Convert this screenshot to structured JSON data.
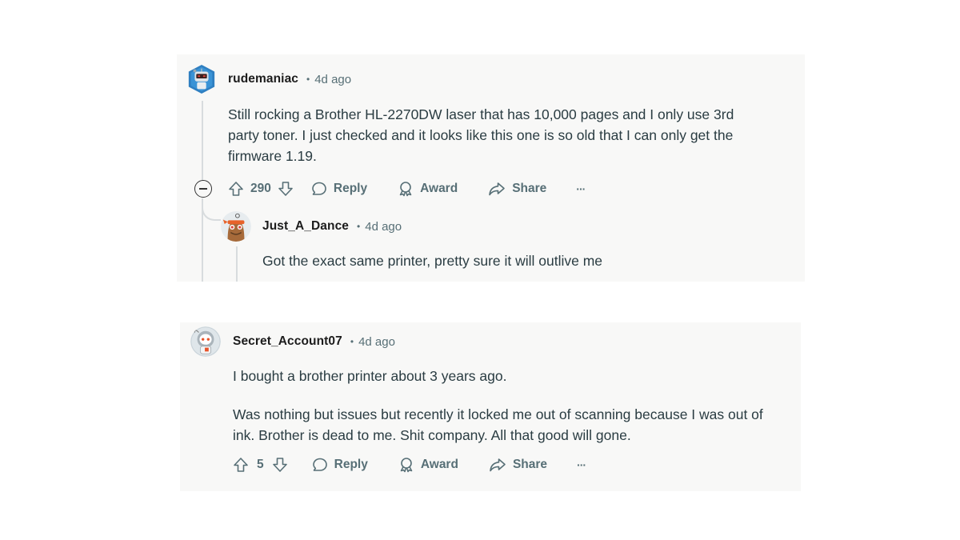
{
  "comments": [
    {
      "username": "rudemaniac",
      "separator": "•",
      "time": "4d ago",
      "avatar": "robot-snoo-avatar",
      "body": [
        "Still rocking a Brother HL-2270DW laser that has 10,000 pages and I only use 3rd",
        "party toner. I just checked and it looks like this one is so old that I can only get the",
        "firmware 1.19."
      ],
      "votes": "290",
      "actions": {
        "reply": "Reply",
        "award": "Award",
        "share": "Share",
        "more": "···"
      },
      "collapse": "collapse-thread",
      "replies": [
        {
          "username": "Just_A_Dance",
          "separator": "•",
          "time": "4d ago",
          "avatar": "pirate-snoo-avatar",
          "body": [
            "Got the exact same printer, pretty sure it will outlive me"
          ]
        }
      ]
    },
    {
      "username": "Secret_Account07",
      "separator": "•",
      "time": "4d ago",
      "avatar": "astronaut-snoo-avatar",
      "body": [
        "I bought a brother printer about 3 years ago.",
        "Was nothing but issues but recently it locked me out of scanning because I was out of ink. Brother is dead to me. Shit company. All that good will gone."
      ],
      "votes": "5",
      "actions": {
        "reply": "Reply",
        "award": "Award",
        "share": "Share",
        "more": "···"
      }
    }
  ],
  "colors": {
    "card_bg": "#f8f8f7",
    "text": "#2a3c42",
    "meta": "#576f76",
    "thread_line": "#d8dcde"
  }
}
